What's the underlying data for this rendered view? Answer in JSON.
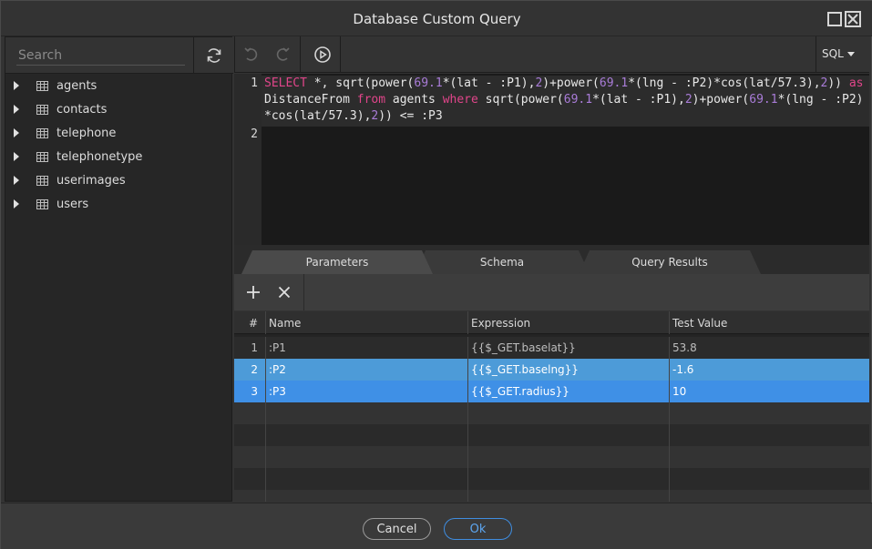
{
  "window": {
    "title": "Database Custom Query"
  },
  "sidebar": {
    "search_placeholder": "Search",
    "tables": [
      "agents",
      "contacts",
      "telephone",
      "telephonetype",
      "userimages",
      "users"
    ]
  },
  "toolbar": {
    "language": "SQL"
  },
  "editor": {
    "line_numbers": [
      "1",
      "2"
    ],
    "line1_tokens": [
      {
        "t": "SELECT",
        "c": "kw"
      },
      {
        "t": " *, sqrt(power(",
        "c": ""
      },
      {
        "t": "69.1",
        "c": "num"
      },
      {
        "t": "*(lat - :P1),",
        "c": ""
      },
      {
        "t": "2",
        "c": "num"
      },
      {
        "t": ")+power(",
        "c": ""
      },
      {
        "t": "69.1",
        "c": "num"
      },
      {
        "t": "*(lng - :P2)*cos(lat/57.3),",
        "c": ""
      },
      {
        "t": "2",
        "c": "num"
      },
      {
        "t": ")) ",
        "c": ""
      },
      {
        "t": "as",
        "c": "kw"
      },
      {
        "t": " DistanceFrom ",
        "c": ""
      },
      {
        "t": "from",
        "c": "kw"
      },
      {
        "t": " agents ",
        "c": ""
      },
      {
        "t": "where",
        "c": "kw"
      },
      {
        "t": " sqrt(power(",
        "c": ""
      },
      {
        "t": "69.1",
        "c": "num"
      },
      {
        "t": "*(lat - :P1),",
        "c": ""
      },
      {
        "t": "2",
        "c": "num"
      },
      {
        "t": ")+power(",
        "c": ""
      },
      {
        "t": "69.1",
        "c": "num"
      },
      {
        "t": "*(lng - :P2)*cos(lat/57.3),",
        "c": ""
      },
      {
        "t": "2",
        "c": "num"
      },
      {
        "t": ")) <= :P3",
        "c": ""
      }
    ]
  },
  "tabs": {
    "parameters": "Parameters",
    "schema": "Schema",
    "query_results": "Query Results"
  },
  "params_table": {
    "headers": {
      "index": "#",
      "name": "Name",
      "expression": "Expression",
      "test_value": "Test Value"
    },
    "rows": [
      {
        "index": "1",
        "name": ":P1",
        "expression": "{{$_GET.baselat}}",
        "test_value": "53.8"
      },
      {
        "index": "2",
        "name": ":P2",
        "expression": "{{$_GET.baselng}}",
        "test_value": "-1.6"
      },
      {
        "index": "3",
        "name": ":P3",
        "expression": "{{$_GET.radius}}",
        "test_value": "10"
      }
    ]
  },
  "footer": {
    "cancel_label": "Cancel",
    "ok_label": "Ok"
  },
  "colors": {
    "keyword": "#e0458a",
    "number": "#a97cd8",
    "selected_row": "#3f90e6",
    "ok_accent": "#3f8de0"
  }
}
